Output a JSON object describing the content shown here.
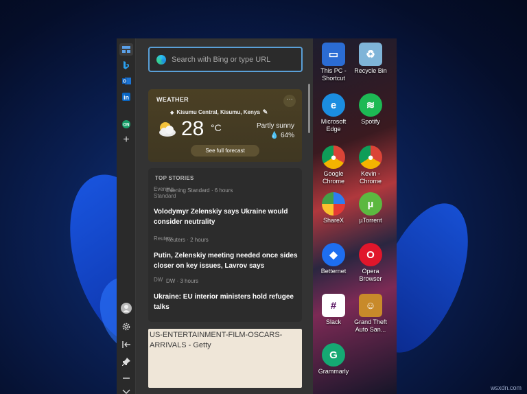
{
  "rail": {
    "items": [
      {
        "name": "widgets-icon"
      },
      {
        "name": "bing-icon"
      },
      {
        "name": "outlook-icon"
      },
      {
        "name": "linkedin-icon"
      },
      {
        "name": "onenote-icon"
      },
      {
        "name": "add-icon"
      }
    ],
    "bottom": [
      {
        "name": "avatar"
      },
      {
        "name": "settings-icon"
      },
      {
        "name": "collapse-icon"
      },
      {
        "name": "pin-icon"
      },
      {
        "name": "minimize-icon"
      },
      {
        "name": "chevron-down-icon"
      }
    ]
  },
  "search": {
    "placeholder": "Search with Bing or type URL"
  },
  "weather": {
    "title": "WEATHER",
    "location": "Kisumu Central, Kisumu, Kenya",
    "temp": "28",
    "unit": "°C",
    "condition": "Partly sunny",
    "humidity": "64%",
    "forecast_label": "See full forecast",
    "more": "···"
  },
  "stories": {
    "title": "TOP STORIES",
    "items": [
      {
        "logo_alt": "Evening Standard",
        "source": "Evening Standard · 6 hours",
        "headline": "Volodymyr Zelenskiy says Ukraine would consider neutrality"
      },
      {
        "logo_alt": "Reuters",
        "source": "Reuters · 2 hours",
        "headline": "Putin, Zelenskiy meeting needed once sides closer on key issues, Lavrov says"
      },
      {
        "logo_alt": "DW",
        "source": "DW · 3 hours",
        "headline": "Ukraine: EU interior ministers hold refugee talks"
      }
    ]
  },
  "image_card": {
    "alt": "US-ENTERTAINMENT-FILM-OSCARS-ARRIVALS - Getty"
  },
  "desktop": {
    "icons": [
      {
        "label": "This PC - Shortcut",
        "icon": "monitor-icon",
        "color": "#2b6cd4"
      },
      {
        "label": "Recycle Bin",
        "icon": "recycle-bin-icon",
        "color": "#7fb4d8"
      },
      {
        "label": "Microsoft Edge",
        "icon": "edge-icon",
        "color": "#1b8de0"
      },
      {
        "label": "Spotify",
        "icon": "spotify-icon",
        "color": "#1db954"
      },
      {
        "label": "Google Chrome",
        "icon": "chrome-icon",
        "color": "#e0a020"
      },
      {
        "label": "Kevin - Chrome",
        "icon": "chrome-profile-icon",
        "color": "#d44b3a"
      },
      {
        "label": "ShareX",
        "icon": "sharex-icon",
        "color": "#2f7cf0"
      },
      {
        "label": "µTorrent",
        "icon": "utorrent-icon",
        "color": "#5cb840"
      },
      {
        "label": "Betternet",
        "icon": "betternet-icon",
        "color": "#1e6ef0"
      },
      {
        "label": "Opera Browser",
        "icon": "opera-icon",
        "color": "#e0162b"
      },
      {
        "label": "Slack",
        "icon": "slack-icon",
        "color": "#ffffff"
      },
      {
        "label": "Grand Theft Auto San...",
        "icon": "gta-icon",
        "color": "#c88a2a"
      },
      {
        "label": "Grammarly",
        "icon": "grammarly-icon",
        "color": "#15a873"
      }
    ]
  },
  "watermark": "wsxdn.com"
}
